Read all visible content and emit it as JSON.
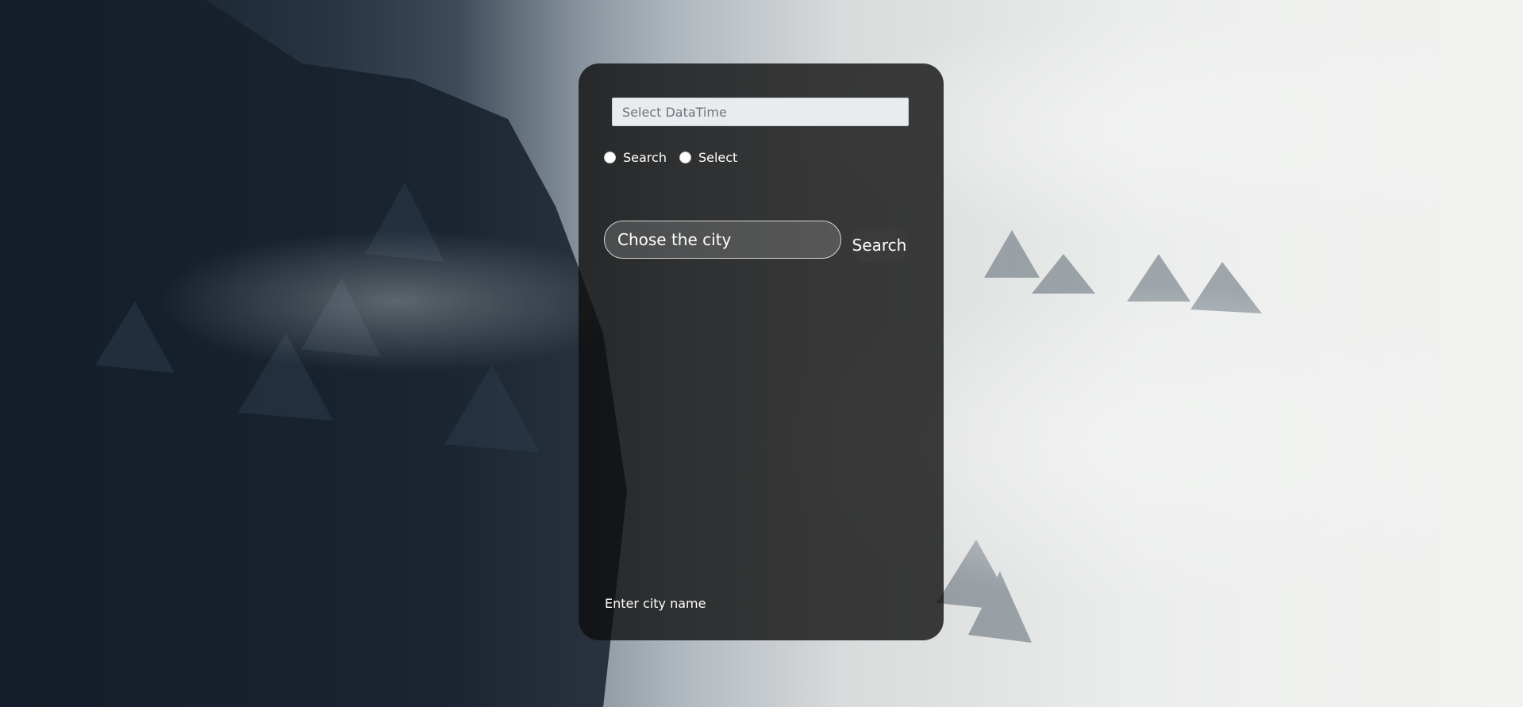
{
  "datetime": {
    "placeholder": "Select DataTime"
  },
  "mode": {
    "options": [
      {
        "label": "Search"
      },
      {
        "label": "Select"
      }
    ]
  },
  "city_search": {
    "placeholder": "Chose the city",
    "button_label": "Search"
  },
  "hint": "Enter city name",
  "colors": {
    "card_bg": "#1a1a1a",
    "input_bg": "#e9ecef"
  }
}
